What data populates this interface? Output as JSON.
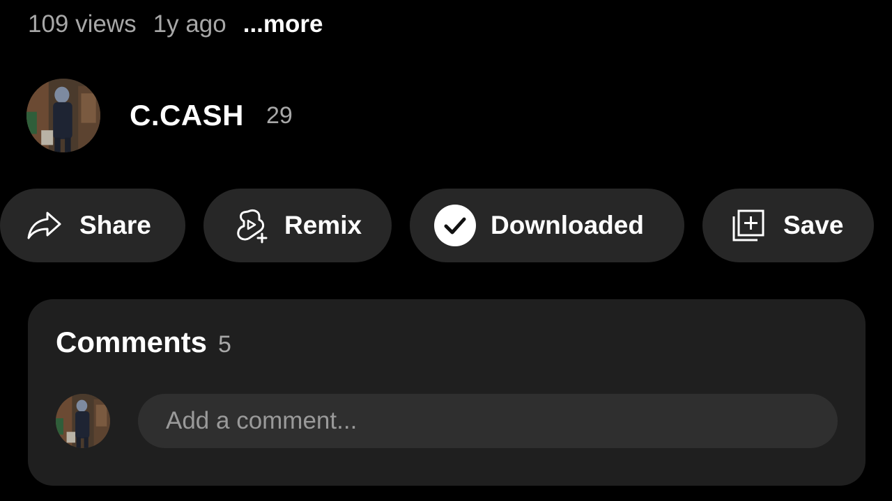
{
  "meta": {
    "views": "109 views",
    "age": "1y ago",
    "more_label": "...more"
  },
  "channel": {
    "name": "C.CASH",
    "subscriber_count": "29",
    "avatar": "channel-avatar-photo"
  },
  "actions": [
    {
      "label": "Share",
      "icon": "share-arrow-icon"
    },
    {
      "label": "Remix",
      "icon": "remix-icon"
    },
    {
      "label": "Downloaded",
      "icon": "check-circle-icon"
    },
    {
      "label": "Save",
      "icon": "add-to-playlist-icon"
    }
  ],
  "comments": {
    "title": "Comments",
    "count": "5",
    "input_placeholder": "Add a comment..."
  },
  "colors": {
    "background": "#000000",
    "chip": "#272727",
    "card": "#1f1f1f",
    "input": "#2f2f2f",
    "secondary_text": "#a8a8a8"
  }
}
